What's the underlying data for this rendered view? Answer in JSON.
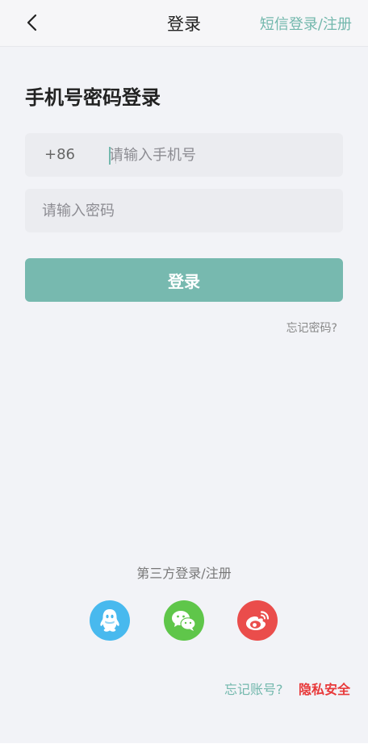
{
  "header": {
    "back_icon": "chevron-left-icon",
    "title": "登录",
    "sms_login_label": "短信登录/注册"
  },
  "main": {
    "title": "手机号密码登录",
    "phone": {
      "country_code": "+86",
      "placeholder": "请输入手机号",
      "value": ""
    },
    "password": {
      "placeholder": "请输入密码",
      "value": ""
    },
    "login_label": "登录",
    "forgot_password_label": "忘记密码?"
  },
  "third_party": {
    "title": "第三方登录/注册",
    "providers": [
      {
        "name": "qq-icon",
        "color": "#48b9ee"
      },
      {
        "name": "wechat-icon",
        "color": "#5fc64a"
      },
      {
        "name": "weibo-icon",
        "color": "#ea4d4b"
      }
    ]
  },
  "footer": {
    "forgot_account_label": "忘记账号?",
    "privacy_label": "隐私安全"
  },
  "colors": {
    "accent": "#73b8ad",
    "button": "#77b9af",
    "danger": "#e8393a",
    "background": "#f2f3f7"
  }
}
